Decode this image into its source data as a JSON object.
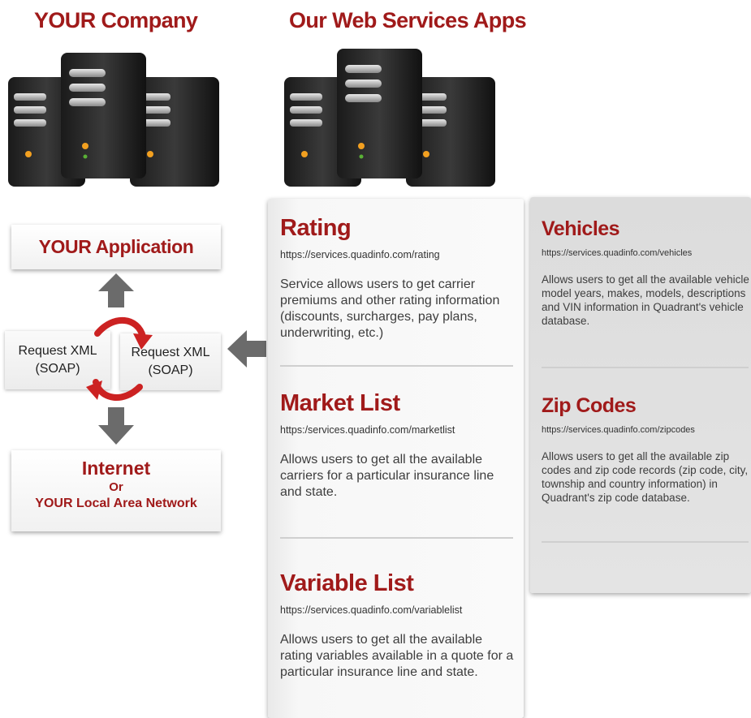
{
  "headings": {
    "your_company": "YOUR Company",
    "web_services": "Our Web Services Apps"
  },
  "left_diagram": {
    "your_application": "YOUR Application",
    "request_left": {
      "line1": "Request XML",
      "line2": "(SOAP)"
    },
    "request_right": {
      "line1": "Request XML",
      "line2": "(SOAP)"
    },
    "internet": {
      "line1": "Internet",
      "line2": "Or",
      "line3": "YOUR Local Area Network"
    }
  },
  "services_left": [
    {
      "name": "Rating",
      "url": "https://services.quadinfo.com/rating",
      "description": "Service allows users to get carrier premiums and other rating information (discounts, surcharges, pay plans, underwriting, etc.)"
    },
    {
      "name": "Market List",
      "url": "https:/services.quadinfo.com/marketlist",
      "description": "Allows users to get all the available carriers for a particular insurance line and state."
    },
    {
      "name": "Variable List",
      "url": "https://services.quadinfo.com/variablelist",
      "description": "Allows users to get all the available rating variables available in a quote for a particular insurance line and state."
    }
  ],
  "services_right": [
    {
      "name": "Vehicles",
      "url": "https://services.quadinfo.com/vehicles",
      "description": "Allows users to get all the available vehicle model years, makes, models, descriptions and VIN information in Quadrant's vehicle database."
    },
    {
      "name": "Zip Codes",
      "url": "https://services.quadinfo.com/zipcodes",
      "description": "Allows users to get all the available zip codes and zip code records (zip code, city, township and country information) in Quadrant's zip code database."
    }
  ],
  "colors": {
    "accent_red": "#a01a1a",
    "arrow_gray": "#6b6b6b",
    "curve_red": "#cc2222"
  },
  "icons": [
    "server-icon",
    "up-arrow-icon",
    "down-arrow-icon",
    "left-arrow-icon",
    "cycle-arrow-icon"
  ]
}
